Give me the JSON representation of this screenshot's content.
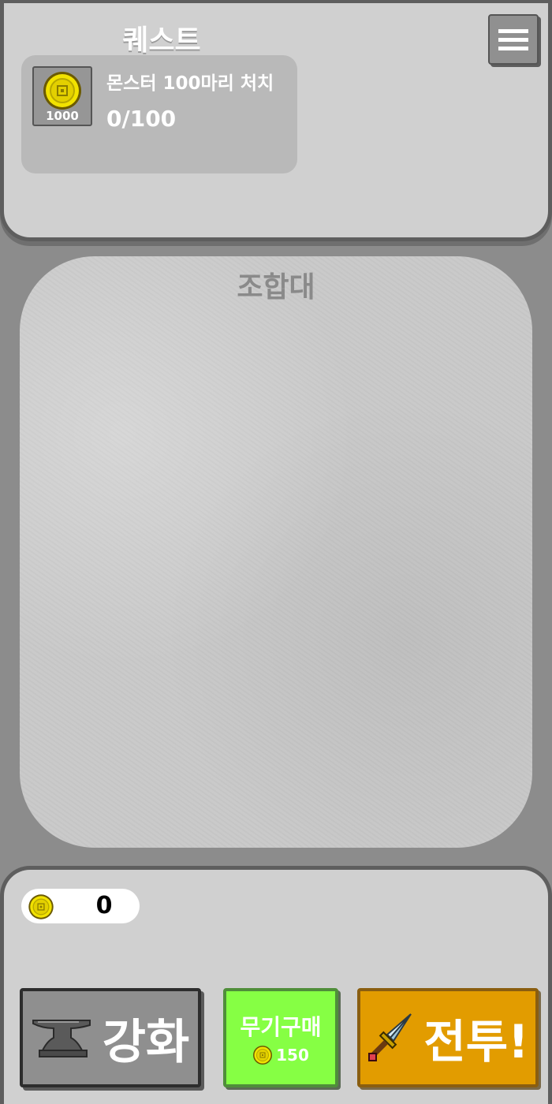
{
  "quest": {
    "title": "퀘스트",
    "menu_icon": "hamburger-menu-icon",
    "card": {
      "reward_icon": "gold-coin-icon",
      "reward_amount": "1000",
      "name": "몬스터 100마리 처치",
      "progress": "0/100"
    }
  },
  "crafting": {
    "title": "조합대"
  },
  "bottom": {
    "gold": {
      "icon": "gold-coin-icon",
      "amount": "0"
    },
    "enhance_button": {
      "label": "강화",
      "icon": "anvil-icon"
    },
    "buy_button": {
      "label": "무기구매",
      "price": "150",
      "icon": "gold-coin-icon"
    },
    "fight_button": {
      "label": "전투!",
      "icon": "sword-icon"
    }
  },
  "colors": {
    "panel": "#d0d0d0",
    "background": "#8c8c8c",
    "buy_green": "#86ff44",
    "fight_orange": "#e29c00",
    "coin_yellow": "#f2e200"
  }
}
